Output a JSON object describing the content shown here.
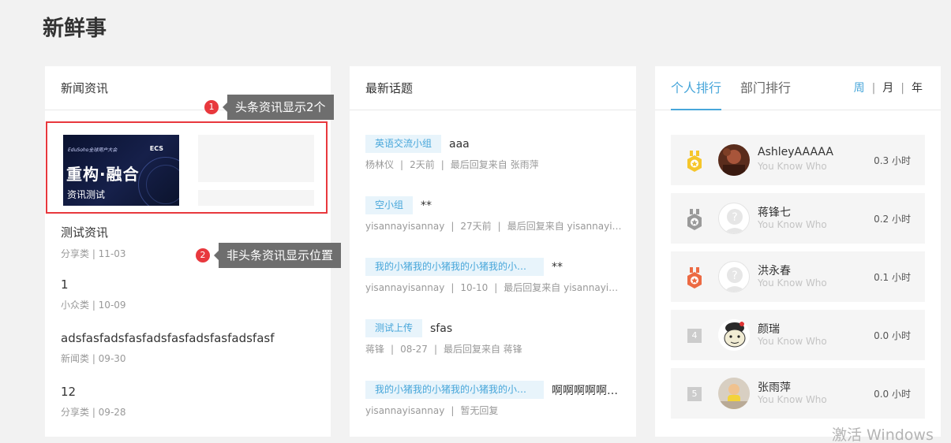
{
  "page": {
    "title": "新鲜事"
  },
  "news": {
    "header": "新闻资讯",
    "headline": {
      "caption": "资讯测试",
      "thumb_top": "EduSoho全球用户大会",
      "thumb_brand": "ECS",
      "thumb_big": "重构·融合"
    },
    "items": [
      {
        "title": "测试资讯",
        "meta": "分享类 | 11-03"
      },
      {
        "title": "1",
        "meta": "小众类 | 10-09"
      },
      {
        "title": "adsfasfadsfasfadsfasfadsfasfadsfasf",
        "meta": "新闻类 | 09-30"
      },
      {
        "title": "12",
        "meta": "分享类 | 09-28"
      }
    ]
  },
  "annotations": [
    {
      "number": "1",
      "text": "头条资讯显示2个"
    },
    {
      "number": "2",
      "text": "非头条资讯显示位置"
    }
  ],
  "topics": {
    "header": "最新话题",
    "items": [
      {
        "tag": "英语交流小组",
        "name": "aaa",
        "author": "杨林仪",
        "time": "2天前",
        "reply": "最后回复来自 张雨萍"
      },
      {
        "tag": "空小组",
        "name": "**",
        "author": "yisannayisannay",
        "time": "27天前",
        "reply": "最后回复来自 yisannayisannay"
      },
      {
        "tag": "我的小猪我的小猪我的小猪我的小猪我的小猪",
        "name": "**",
        "author": "yisannayisannay",
        "time": "10-10",
        "reply": "最后回复来自 yisannayisannay"
      },
      {
        "tag": "测试上传",
        "name": "sfas",
        "author": "蒋锋",
        "time": "08-27",
        "reply": "最后回复来自 蒋锋"
      },
      {
        "tag": "我的小猪我的小猪我的小猪我的小猪我的小猪",
        "name": "啊啊啊啊啊啊啊",
        "author": "yisannayisannay",
        "time": "",
        "reply": "暂无回复"
      }
    ]
  },
  "ranking": {
    "tabs": [
      "个人排行",
      "部门排行"
    ],
    "periods": [
      "周",
      "月",
      "年"
    ],
    "rows": [
      {
        "rank": "1",
        "name": "AshleyAAAAA",
        "sub": "You Know Who",
        "hours": "0.3 小时",
        "medal_color": "#f5c62b"
      },
      {
        "rank": "2",
        "name": "蒋锋七",
        "sub": "You Know Who",
        "hours": "0.2 小时",
        "medal_color": "#9a9a9a"
      },
      {
        "rank": "3",
        "name": "洪永春",
        "sub": "You Know Who",
        "hours": "0.1 小时",
        "medal_color": "#ec6a43"
      },
      {
        "rank": "4",
        "name": "颜瑞",
        "sub": "You Know Who",
        "hours": "0.0 小时"
      },
      {
        "rank": "5",
        "name": "张雨萍",
        "sub": "You Know Who",
        "hours": "0.0 小时"
      }
    ]
  },
  "watermark": "激活 Windows"
}
